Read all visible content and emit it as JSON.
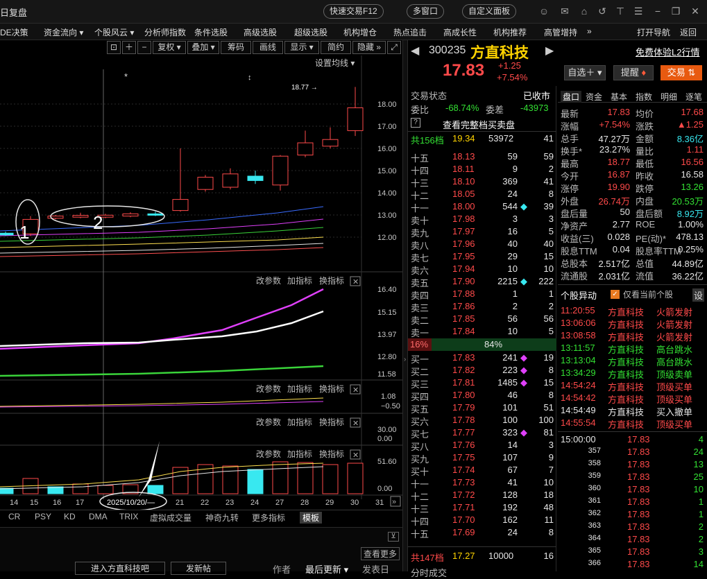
{
  "window": {
    "title": "日复盘",
    "buttons": [
      "快速交易F12",
      "多窗口",
      "自定义面板"
    ]
  },
  "menu": [
    "DE决策",
    "资金流向 ▾",
    "个股风云 ▾",
    "分析师指数",
    "条件选股",
    "高级选股",
    "超级选股",
    "机构增仓",
    "热点追击",
    "高成长性",
    "机构推荐",
    "高管增持",
    "»",
    "打开导航",
    "返回"
  ],
  "toolbar": {
    "buttons": [
      "复权 ▾",
      "叠加 ▾",
      "筹码",
      "画线",
      "显示 ▾",
      "简约",
      "隐藏 »"
    ],
    "settings": "设置均线 ▾",
    "high_label": "18.77 →",
    "marks": [
      "*",
      "↕"
    ]
  },
  "chart_data": {
    "type": "candlestick",
    "x": [
      "14",
      "15",
      "16",
      "17",
      "20",
      "21",
      "22",
      "23",
      "24",
      "27",
      "28",
      "29",
      "30",
      "31"
    ],
    "y_ticks": [
      "18.00",
      "17.00",
      "16.00",
      "15.00",
      "14.00",
      "13.00",
      "12.00"
    ],
    "candles": [
      {
        "o": 12.18,
        "c": 12.1,
        "h": 12.25,
        "l": 12.05
      },
      {
        "o": 12.15,
        "c": 12.8,
        "h": 12.95,
        "l": 12.05
      },
      {
        "o": 12.85,
        "c": 12.95,
        "h": 13.0,
        "l": 12.8
      },
      {
        "o": 12.9,
        "c": 12.98,
        "h": 13.1,
        "l": 12.85
      },
      {
        "o": 12.9,
        "c": 12.99,
        "h": 13.05,
        "l": 12.85
      },
      {
        "o": 12.95,
        "c": 13.05,
        "h": 13.12,
        "l": 12.9
      },
      {
        "o": 13.05,
        "c": 13.0,
        "h": 13.15,
        "l": 12.95
      },
      {
        "o": 13.2,
        "c": 13.7,
        "h": 16.0,
        "l": 13.15
      },
      {
        "o": 14.15,
        "c": 14.7,
        "h": 14.8,
        "l": 14.05
      },
      {
        "o": 14.25,
        "c": 14.85,
        "h": 15.1,
        "l": 14.15
      },
      {
        "o": 14.75,
        "c": 14.55,
        "h": 15.0,
        "l": 14.4
      },
      {
        "o": 14.35,
        "c": 15.65,
        "h": 15.7,
        "l": 14.1
      },
      {
        "o": 15.7,
        "c": 16.25,
        "h": 16.8,
        "l": 15.6
      },
      {
        "o": 16.1,
        "c": 16.4,
        "h": 16.95,
        "l": 16.0
      },
      {
        "o": 16.8,
        "c": 17.83,
        "h": 18.77,
        "l": 16.56
      }
    ],
    "annotations": [
      "1",
      "2",
      "2025/10/20/—"
    ],
    "sub1_ticks": [
      "16.40",
      "15.15",
      "13.97",
      "12.80",
      "11.58"
    ],
    "sub2_ticks": [
      "1.08",
      "−0.50"
    ],
    "sub3_ticks": [
      "30.00",
      "0.00"
    ],
    "sub4_ticks": [
      "51.60",
      "0.00"
    ],
    "volume": [
      8,
      22,
      10,
      14,
      12,
      13,
      12,
      38,
      42,
      40,
      35,
      46,
      45,
      42,
      44
    ],
    "volume_colors": [
      "cyan",
      "red",
      "cyan",
      "red",
      "red",
      "red",
      "cyan",
      "red",
      "red",
      "red",
      "cyan",
      "red",
      "red",
      "red",
      "red"
    ]
  },
  "panel_controls": [
    "改参数",
    "加指标",
    "换指标",
    "✕"
  ],
  "indicator_tabs": [
    "CR",
    "PSY",
    "KD",
    "DMA",
    "TRIX",
    "虚拟成交量",
    "神奇九转",
    "更多指标",
    "模板"
  ],
  "footer": {
    "view_more": "查看更多",
    "enter": "进入方直科技吧",
    "post": "发新帖",
    "author": "作者",
    "latest": "最后更新 ▾",
    "publish": "发表日"
  },
  "stock": {
    "code": "300235",
    "name": "方直科技",
    "trial": "免费体验L2行情",
    "price": "17.83",
    "change": "+1.25",
    "pct": "+7.54%",
    "btn_watch": "自选＋ ▾",
    "btn_alert": "提醒",
    "btn_trade": "交易"
  },
  "orderbook": {
    "status_label": "交易状态",
    "status": "已收市",
    "weibi_label": "委比",
    "weibi": "-68.74%",
    "weicha_label": "委差",
    "weicha": "-43973",
    "view_full": "查看完整档买卖盘",
    "sell_total": {
      "label": "共156档",
      "price": "19.34",
      "vol": "53972",
      "num": "41"
    },
    "asks": [
      [
        "十五",
        "18.13",
        "59",
        "59",
        ""
      ],
      [
        "十四",
        "18.11",
        "9",
        "2",
        ""
      ],
      [
        "十三",
        "18.10",
        "369",
        "41",
        ""
      ],
      [
        "十二",
        "18.05",
        "24",
        "8",
        ""
      ],
      [
        "十一",
        "18.00",
        "544",
        "39",
        "◆"
      ],
      [
        "卖十",
        "17.98",
        "3",
        "3",
        ""
      ],
      [
        "卖九",
        "17.97",
        "16",
        "5",
        ""
      ],
      [
        "卖八",
        "17.96",
        "40",
        "40",
        ""
      ],
      [
        "卖七",
        "17.95",
        "29",
        "15",
        ""
      ],
      [
        "卖六",
        "17.94",
        "10",
        "10",
        ""
      ],
      [
        "卖五",
        "17.90",
        "2215",
        "222",
        "◆"
      ],
      [
        "卖四",
        "17.88",
        "1",
        "1",
        ""
      ],
      [
        "卖三",
        "17.86",
        "2",
        "2",
        ""
      ],
      [
        "卖二",
        "17.85",
        "56",
        "56",
        ""
      ],
      [
        "卖一",
        "17.84",
        "10",
        "5",
        ""
      ]
    ],
    "ratio_left": "16%",
    "ratio_right": "84%",
    "bids": [
      [
        "买一",
        "17.83",
        "241",
        "19",
        "◆"
      ],
      [
        "买二",
        "17.82",
        "223",
        "8",
        "◆"
      ],
      [
        "买三",
        "17.81",
        "1485",
        "15",
        "◆"
      ],
      [
        "买四",
        "17.80",
        "46",
        "8",
        ""
      ],
      [
        "买五",
        "17.79",
        "101",
        "51",
        ""
      ],
      [
        "买六",
        "17.78",
        "100",
        "100",
        ""
      ],
      [
        "买七",
        "17.77",
        "323",
        "81",
        "◆"
      ],
      [
        "买八",
        "17.76",
        "14",
        "3",
        ""
      ],
      [
        "买九",
        "17.75",
        "107",
        "9",
        ""
      ],
      [
        "买十",
        "17.74",
        "67",
        "7",
        ""
      ],
      [
        "十一",
        "17.73",
        "41",
        "10",
        ""
      ],
      [
        "十二",
        "17.72",
        "128",
        "18",
        ""
      ],
      [
        "十三",
        "17.71",
        "192",
        "48",
        ""
      ],
      [
        "十四",
        "17.70",
        "162",
        "11",
        ""
      ],
      [
        "十五",
        "17.69",
        "24",
        "8",
        ""
      ]
    ],
    "buy_total": {
      "label": "共147档",
      "price": "17.27",
      "vol": "10000",
      "num": "16"
    },
    "next_section": "分时成交"
  },
  "quote_tabs": [
    "盘口",
    "资金",
    "基本",
    "指数",
    "明细",
    "逐笔"
  ],
  "quote": [
    [
      "最新",
      "17.83",
      "red",
      "均价",
      "17.68",
      "red"
    ],
    [
      "涨幅",
      "+7.54%",
      "red",
      "涨跌",
      "▲1.25",
      "red"
    ],
    [
      "总手",
      "47.27万",
      "white",
      "金额",
      "8.36亿",
      "cyan"
    ],
    [
      "换手*",
      "23.27%",
      "white",
      "量比",
      "1.11",
      "red"
    ],
    [
      "最高",
      "18.77",
      "red",
      "最低",
      "16.56",
      "red"
    ],
    [
      "今开",
      "16.87",
      "red",
      "昨收",
      "16.58",
      "white"
    ],
    [
      "涨停",
      "19.90",
      "red",
      "跌停",
      "13.26",
      "green"
    ],
    [
      "外盘",
      "26.74万",
      "red",
      "内盘",
      "20.53万",
      "green"
    ],
    [
      "盘后量",
      "50",
      "white",
      "盘后额",
      "8.92万",
      "cyan"
    ],
    [
      "净资产",
      "2.77",
      "white",
      "ROE",
      "1.00%",
      "white"
    ],
    [
      "收益(三)",
      "0.028",
      "white",
      "PE(动)*",
      "478.13",
      "white"
    ],
    [
      "股息TTM",
      "0.04",
      "white",
      "股息率TTM",
      "0.25%",
      "white"
    ],
    [
      "总股本",
      "2.517亿",
      "white",
      "总值",
      "44.89亿",
      "white"
    ],
    [
      "流通股",
      "2.031亿",
      "white",
      "流值",
      "36.22亿",
      "white"
    ]
  ],
  "events": {
    "title": "个股异动",
    "only_current": "仅看当前个股",
    "settings": "设",
    "items": [
      [
        "11:20:55",
        "方直科技",
        "火箭发射",
        "red"
      ],
      [
        "13:06:06",
        "方直科技",
        "火箭发射",
        "red"
      ],
      [
        "13:08:58",
        "方直科技",
        "火箭发射",
        "red"
      ],
      [
        "13:11:57",
        "方直科技",
        "高台跳水",
        "green"
      ],
      [
        "13:13:04",
        "方直科技",
        "高台跳水",
        "green"
      ],
      [
        "13:34:29",
        "方直科技",
        "顶级卖单",
        "green"
      ],
      [
        "14:54:24",
        "方直科技",
        "顶级买单",
        "red"
      ],
      [
        "14:54:42",
        "方直科技",
        "顶级买单",
        "red"
      ],
      [
        "14:54:49",
        "方直科技",
        "买入撤单",
        "white"
      ],
      [
        "14:55:54",
        "方直科技",
        "顶级买单",
        "red"
      ]
    ]
  },
  "ticks": [
    [
      "15:00:00",
      "17.83",
      "4",
      "green"
    ],
    [
      "357",
      "17.83",
      "24",
      "green"
    ],
    [
      "358",
      "17.83",
      "13",
      "green"
    ],
    [
      "359",
      "17.83",
      "25",
      "green"
    ],
    [
      "360",
      "17.83",
      "10",
      "green"
    ],
    [
      "361",
      "17.83",
      "1",
      "green"
    ],
    [
      "362",
      "17.83",
      "1",
      "green"
    ],
    [
      "363",
      "17.83",
      "2",
      "green"
    ],
    [
      "364",
      "17.83",
      "2",
      "green"
    ],
    [
      "365",
      "17.83",
      "3",
      "green"
    ],
    [
      "366",
      "17.83",
      "14",
      "green"
    ]
  ]
}
